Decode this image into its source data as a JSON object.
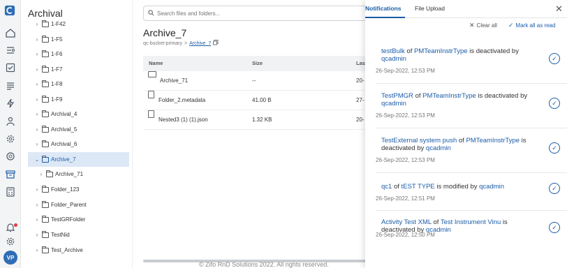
{
  "sidebar_rail": {
    "icons": [
      "logo-icon",
      "home-icon",
      "workflow-icon",
      "checklist-icon",
      "list-icon",
      "lightning-icon",
      "users-icon",
      "settings-gear-icon",
      "archive-icon",
      "calculator-icon",
      "notification-bell-icon",
      "gear-icon"
    ],
    "avatar": "VP"
  },
  "tree": {
    "title": "Archival",
    "items": [
      {
        "label": "1-F42"
      },
      {
        "label": "1-F5"
      },
      {
        "label": "1-F6"
      },
      {
        "label": "1-F7"
      },
      {
        "label": "1-F8"
      },
      {
        "label": "1-F9"
      },
      {
        "label": "Archival_4"
      },
      {
        "label": "Archival_5"
      },
      {
        "label": "Archival_6"
      },
      {
        "label": "Archive_7"
      },
      {
        "label": "Archive_71"
      },
      {
        "label": "Folder_123"
      },
      {
        "label": "Folder_Parent"
      },
      {
        "label": "TestGRFolder"
      },
      {
        "label": "TestNid"
      },
      {
        "label": "Test_Archive"
      }
    ]
  },
  "main": {
    "search_placeholder": "Search files and folders...",
    "title": "Archive_7",
    "breadcrumb": {
      "root": "qc-bucket-primary",
      "sep": ">",
      "current": "Archive_7"
    },
    "columns": [
      "Name",
      "Size",
      "Las"
    ],
    "rows": [
      {
        "name": "Archive_71",
        "size": "--",
        "date": "20-"
      },
      {
        "name": "Folder_2.metadata",
        "size": "41.00 B",
        "date": "27-"
      },
      {
        "name": "Nested3 (1) (1).json",
        "size": "1.32 KB",
        "date": "20-"
      }
    ],
    "footer": "© Zifo RnD Solutions 2022. All rights reserved."
  },
  "panel": {
    "tabs": [
      "Notifications",
      "File Upload"
    ],
    "clear_all": "Clear all",
    "mark_all": "Mark all as read",
    "notifications": [
      {
        "a": "testBulk",
        "b": " of ",
        "c": "PMTeamInstrType",
        "d": " is deactivated by ",
        "e": "qcadmin",
        "time": "26-Sep-2022, 12:53 PM"
      },
      {
        "a": "TestPMGR",
        "b": " of ",
        "c": "PMTeamInstrType",
        "d": " is deactivated by ",
        "e": "qcadmin",
        "time": "26-Sep-2022, 12:53 PM"
      },
      {
        "a": "TestExternal system push",
        "b": " of ",
        "c": "PMTeamInstrType",
        "d": " is deactivated by ",
        "e": "qcadmin",
        "time": "26-Sep-2022, 12:53 PM"
      },
      {
        "a": "qc1",
        "b": " of ",
        "c": "tEST TYPE",
        "d": " is modified by ",
        "e": "qcadmin",
        "time": "26-Sep-2022, 12:51 PM"
      },
      {
        "a": "Activity Test XML",
        "b": " of ",
        "c": "Test Instrument Vinu",
        "d": " is deactivated by ",
        "e": "qcadmin",
        "time": "26-Sep-2022, 12:50 PM"
      }
    ]
  }
}
